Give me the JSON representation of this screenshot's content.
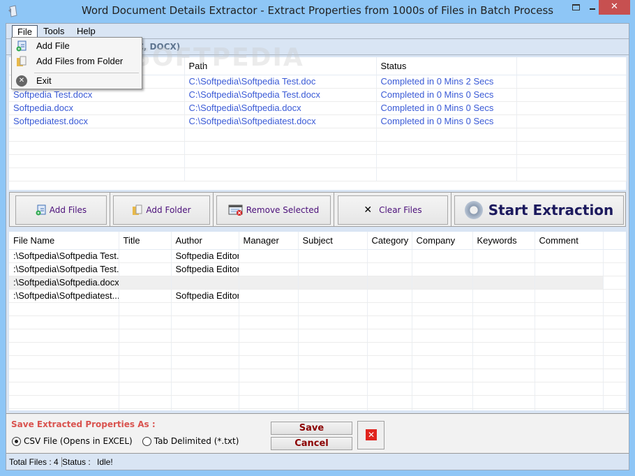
{
  "window": {
    "title": "Word Document Details Extractor - Extract Properties from 1000s of Files in Batch Process",
    "close_glyph": "✕",
    "restore_glyph": "☐"
  },
  "menubar": {
    "items": [
      {
        "label": "File"
      },
      {
        "label": "Tools"
      },
      {
        "label": "Help"
      }
    ]
  },
  "file_menu": {
    "items": [
      {
        "label": "Add File",
        "icon": "add-file-icon"
      },
      {
        "label": "Add Files from Folder",
        "icon": "folder-icon"
      },
      {
        "label": "Exit",
        "icon": "exit-icon"
      }
    ],
    "exit_glyph": "✕"
  },
  "group_header": {
    "visible_text": "C, DOCX)"
  },
  "watermark": "SOFTPEDIA",
  "files_grid": {
    "columns": [
      "",
      "Path",
      "Status",
      ""
    ],
    "rows": [
      {
        "name": "",
        "path": "C:\\Softpedia\\Softpedia Test.doc",
        "status": "Completed in 0 Mins 2 Secs"
      },
      {
        "name": "Softpedia Test.docx",
        "path": "C:\\Softpedia\\Softpedia Test.docx",
        "status": "Completed in 0 Mins 0 Secs"
      },
      {
        "name": "Softpedia.docx",
        "path": "C:\\Softpedia\\Softpedia.docx",
        "status": "Completed in 0 Mins 0 Secs"
      },
      {
        "name": "Softpediatest.docx",
        "path": "C:\\Softpedia\\Softpediatest.docx",
        "status": "Completed in 0 Mins 0 Secs"
      }
    ]
  },
  "toolbar": {
    "add_files": "Add Files",
    "add_folder": "Add Folder",
    "remove_selected": "Remove Selected",
    "clear_files": "Clear Files",
    "clear_glyph": "✕",
    "start_extraction": "Start Extraction"
  },
  "props_grid": {
    "columns": [
      "File Name",
      "Title",
      "Author",
      "Manager",
      "Subject",
      "Category",
      "Company",
      "Keywords",
      "Comment"
    ],
    "rows": [
      [
        ":\\Softpedia\\Softpedia Test...",
        "",
        "Softpedia Editor",
        "",
        "",
        "",
        "",
        "",
        ""
      ],
      [
        ":\\Softpedia\\Softpedia Test...",
        "",
        "Softpedia Editor",
        "",
        "",
        "",
        "",
        "",
        ""
      ],
      [
        ":\\Softpedia\\Softpedia.docx",
        "",
        "",
        "",
        "",
        "",
        "",
        "",
        ""
      ],
      [
        ":\\Softpedia\\Softpediatest....",
        "",
        "Softpedia Editor",
        "",
        "",
        "",
        "",
        "",
        ""
      ]
    ],
    "selected_row": 2
  },
  "save_panel": {
    "label": "Save Extracted Properties As :",
    "options": [
      {
        "label": "CSV File (Opens in EXCEL)",
        "checked": true
      },
      {
        "label": "Tab Delimited (*.txt)",
        "checked": false
      }
    ],
    "save_button": "Save",
    "cancel_button": "Cancel",
    "close_glyph": "✕"
  },
  "statusbar": {
    "total_files": "Total Files : 4",
    "status_label": "Status :",
    "status_value": "Idle!"
  }
}
